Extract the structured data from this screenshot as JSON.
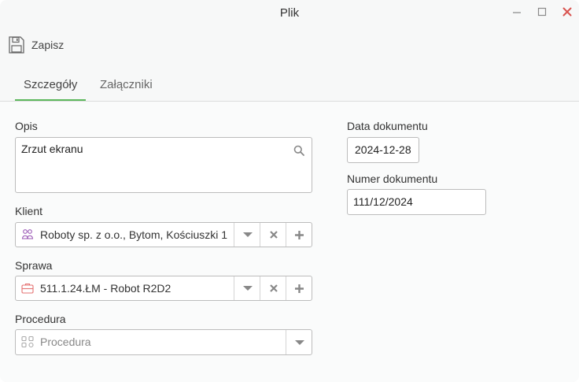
{
  "window": {
    "title": "Plik",
    "minimize_glyph": "—",
    "maximize_glyph": "☐",
    "close_glyph": "✕"
  },
  "toolbar": {
    "save_label": "Zapisz",
    "save_icon": "floppy-disk-icon"
  },
  "tabs": [
    {
      "label": "Szczegóły",
      "active": true
    },
    {
      "label": "Załączniki",
      "active": false
    }
  ],
  "form": {
    "opis": {
      "label": "Opis",
      "value": "Zrzut ekranu"
    },
    "klient": {
      "label": "Klient",
      "value": "Roboty sp. z o.o., Bytom, Kościuszki 1"
    },
    "sprawa": {
      "label": "Sprawa",
      "value": "511.1.24.ŁM - Robot R2D2"
    },
    "procedura": {
      "label": "Procedura",
      "placeholder": "Procedura"
    },
    "data_dokumentu": {
      "label": "Data dokumentu",
      "value": "2024-12-28"
    },
    "numer_dokumentu": {
      "label": "Numer dokumentu",
      "value": "111/12/2024"
    }
  },
  "colors": {
    "accent": "#5cb85c",
    "close": "#d9534f",
    "client_icon": "#9b59b6",
    "case_icon": "#e57373"
  }
}
